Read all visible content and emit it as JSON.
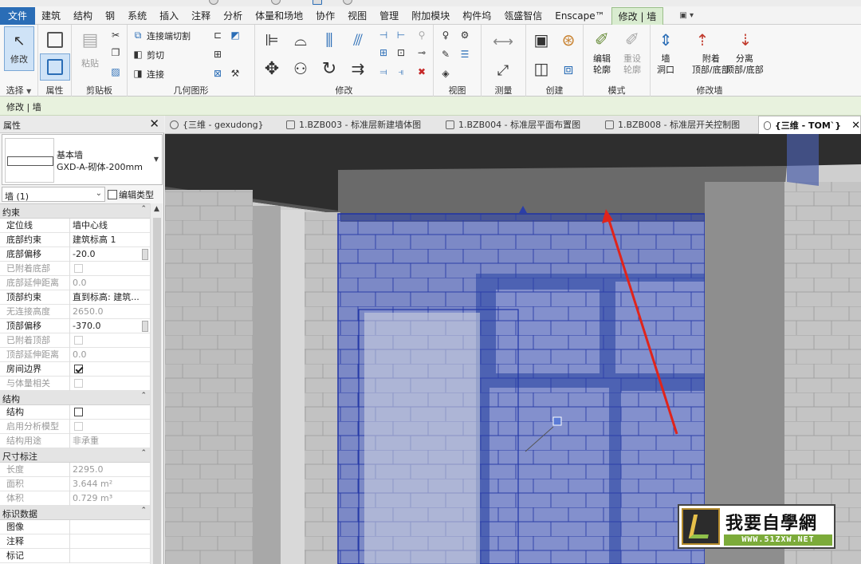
{
  "menu": {
    "tabs": [
      "文件",
      "建筑",
      "结构",
      "钢",
      "系统",
      "插入",
      "注释",
      "分析",
      "体量和场地",
      "协作",
      "视图",
      "管理",
      "附加模块",
      "构件坞",
      "瓴盛智信",
      "Enscape™",
      "修改 | 墙"
    ],
    "extra_dropdown": "▣ ▾"
  },
  "ribbon": {
    "panels": {
      "select": "选择",
      "properties": "属性",
      "clipboard": "剪贴板",
      "geometry": "几何图形",
      "modify": "修改",
      "view": "视图",
      "measure": "测量",
      "create": "创建",
      "mode": "模式",
      "modify_wall": "修改墙"
    },
    "modify_btn": "修改",
    "paste_btn": "粘贴",
    "join_cut": "连接端切割",
    "cut": "剪切",
    "join": "连接",
    "edit_profile": [
      "编辑",
      "轮廓"
    ],
    "reset_profile": [
      "重设",
      "轮廓"
    ],
    "wall_opening": [
      "墙",
      "洞口"
    ],
    "attach_topbase": [
      "附着",
      "顶部/底部"
    ],
    "detach_topbase": [
      "分离",
      "顶部/底部"
    ]
  },
  "options_bar": {
    "label": "修改 | 墙"
  },
  "properties": {
    "title": "属性",
    "family": "基本墙",
    "type": "GXD-A-砌体-200mm",
    "instance": "墙 (1)",
    "edit_type": "编辑类型",
    "groups": [
      {
        "name": "约束",
        "rows": [
          {
            "label": "定位线",
            "value": "墙中心线"
          },
          {
            "label": "底部约束",
            "value": "建筑标高 1"
          },
          {
            "label": "底部偏移",
            "value": "-20.0"
          },
          {
            "label": "已附着底部",
            "check": false,
            "disabled": true
          },
          {
            "label": "底部延伸距离",
            "value": "0.0",
            "disabled": true
          },
          {
            "label": "顶部约束",
            "value": "直到标高: 建筑..."
          },
          {
            "label": "无连接高度",
            "value": "2650.0",
            "disabled": true
          },
          {
            "label": "顶部偏移",
            "value": "-370.0"
          },
          {
            "label": "已附着顶部",
            "check": false,
            "disabled": true
          },
          {
            "label": "顶部延伸距离",
            "value": "0.0",
            "disabled": true
          },
          {
            "label": "房间边界",
            "check": true
          },
          {
            "label": "与体量相关",
            "check": false,
            "disabled": true
          }
        ]
      },
      {
        "name": "结构",
        "rows": [
          {
            "label": "结构",
            "check": false
          },
          {
            "label": "启用分析模型",
            "check": false,
            "disabled": true
          },
          {
            "label": "结构用途",
            "value": "非承重",
            "disabled": true
          }
        ]
      },
      {
        "name": "尺寸标注",
        "rows": [
          {
            "label": "长度",
            "value": "2295.0",
            "disabled": true
          },
          {
            "label": "面积",
            "value": "3.644 m²",
            "disabled": true
          },
          {
            "label": "体积",
            "value": "0.729 m³",
            "disabled": true
          }
        ]
      },
      {
        "name": "标识数据",
        "rows": [
          {
            "label": "图像",
            "value": ""
          },
          {
            "label": "注释",
            "value": ""
          },
          {
            "label": "标记",
            "value": ""
          }
        ]
      }
    ]
  },
  "view_tabs": [
    {
      "label": "{三维 - gexudong}"
    },
    {
      "label": "1.BZB003 - 标准层新建墙体图"
    },
    {
      "label": "1.BZB004 - 标准层平面布置图"
    },
    {
      "label": "1.BZB008 - 标准层开关控制图"
    },
    {
      "label": "{三维 - TOM`}"
    }
  ],
  "watermark": {
    "title": "我要自學網",
    "url": "WWW.51ZXW.NET"
  },
  "colors": {
    "accent": "#2a6db6",
    "selection": "#4a64c8",
    "annotation": "#e0241b"
  }
}
